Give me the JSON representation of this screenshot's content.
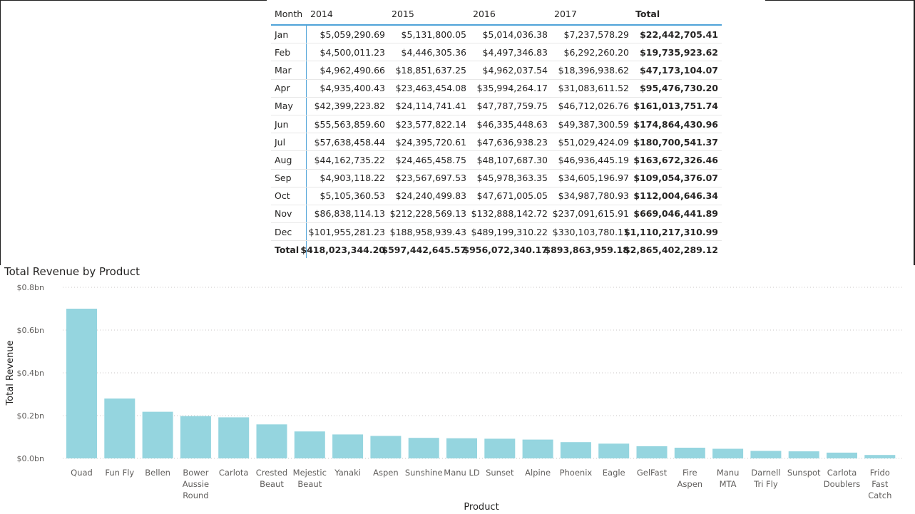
{
  "matrix": {
    "headers": [
      "Month",
      "2014",
      "2015",
      "2016",
      "2017",
      "Total"
    ],
    "rows": [
      {
        "month": "Jan",
        "values": [
          "$5,059,290.69",
          "$5,131,800.05",
          "$5,014,036.38",
          "$7,237,578.29",
          "$22,442,705.41"
        ]
      },
      {
        "month": "Feb",
        "values": [
          "$4,500,011.23",
          "$4,446,305.36",
          "$4,497,346.83",
          "$6,292,260.20",
          "$19,735,923.62"
        ]
      },
      {
        "month": "Mar",
        "values": [
          "$4,962,490.66",
          "$18,851,637.25",
          "$4,962,037.54",
          "$18,396,938.62",
          "$47,173,104.07"
        ]
      },
      {
        "month": "Apr",
        "values": [
          "$4,935,400.43",
          "$23,463,454.08",
          "$35,994,264.17",
          "$31,083,611.52",
          "$95,476,730.20"
        ]
      },
      {
        "month": "May",
        "values": [
          "$42,399,223.82",
          "$24,114,741.41",
          "$47,787,759.75",
          "$46,712,026.76",
          "$161,013,751.74"
        ]
      },
      {
        "month": "Jun",
        "values": [
          "$55,563,859.60",
          "$23,577,822.14",
          "$46,335,448.63",
          "$49,387,300.59",
          "$174,864,430.96"
        ]
      },
      {
        "month": "Jul",
        "values": [
          "$57,638,458.44",
          "$24,395,720.61",
          "$47,636,938.23",
          "$51,029,424.09",
          "$180,700,541.37"
        ]
      },
      {
        "month": "Aug",
        "values": [
          "$44,162,735.22",
          "$24,465,458.75",
          "$48,107,687.30",
          "$46,936,445.19",
          "$163,672,326.46"
        ]
      },
      {
        "month": "Sep",
        "values": [
          "$4,903,118.22",
          "$23,567,697.53",
          "$45,978,363.35",
          "$34,605,196.97",
          "$109,054,376.07"
        ]
      },
      {
        "month": "Oct",
        "values": [
          "$5,105,360.53",
          "$24,240,499.83",
          "$47,671,005.05",
          "$34,987,780.93",
          "$112,004,646.34"
        ]
      },
      {
        "month": "Nov",
        "values": [
          "$86,838,114.13",
          "$212,228,569.13",
          "$132,888,142.72",
          "$237,091,615.91",
          "$669,046,441.89"
        ]
      },
      {
        "month": "Dec",
        "values": [
          "$101,955,281.23",
          "$188,958,939.43",
          "$489,199,310.22",
          "$330,103,780.11",
          "$1,110,217,310.99"
        ]
      }
    ],
    "total": {
      "label": "Total",
      "values": [
        "$418,023,344.20",
        "$597,442,645.57",
        "$956,072,340.17",
        "$893,863,959.18",
        "$2,865,402,289.12"
      ]
    }
  },
  "chart_title": "Total Revenue by Product",
  "chart_data": {
    "type": "bar",
    "title": "Total Revenue by Product",
    "xlabel": "Product",
    "ylabel": "Total Revenue",
    "ylim": [
      0,
      0.8
    ],
    "yticks": [
      "$0.0bn",
      "$0.2bn",
      "$0.4bn",
      "$0.6bn",
      "$0.8bn"
    ],
    "ytick_values": [
      0,
      0.2,
      0.4,
      0.6,
      0.8
    ],
    "grid": true,
    "color": "#95d5df",
    "categories": [
      [
        "Quad"
      ],
      [
        "Fun Fly"
      ],
      [
        "Bellen"
      ],
      [
        "Bower",
        "Aussie",
        "Round"
      ],
      [
        "Carlota"
      ],
      [
        "Crested",
        "Beaut"
      ],
      [
        "Mejestic",
        "Beaut"
      ],
      [
        "Yanaki"
      ],
      [
        "Aspen"
      ],
      [
        "Sunshine"
      ],
      [
        "Manu LD"
      ],
      [
        "Sunset"
      ],
      [
        "Alpine"
      ],
      [
        "Phoenix"
      ],
      [
        "Eagle"
      ],
      [
        "GelFast"
      ],
      [
        "Fire",
        "Aspen"
      ],
      [
        "Manu",
        "MTA"
      ],
      [
        "Darnell",
        "Tri Fly"
      ],
      [
        "Sunspot"
      ],
      [
        "Carlota",
        "Doublers"
      ],
      [
        "Frido",
        "Fast",
        "Catch"
      ]
    ],
    "values": [
      0.7,
      0.28,
      0.218,
      0.198,
      0.192,
      0.159,
      0.126,
      0.112,
      0.105,
      0.096,
      0.094,
      0.092,
      0.088,
      0.076,
      0.069,
      0.057,
      0.05,
      0.045,
      0.035,
      0.033,
      0.027,
      0.016
    ]
  }
}
